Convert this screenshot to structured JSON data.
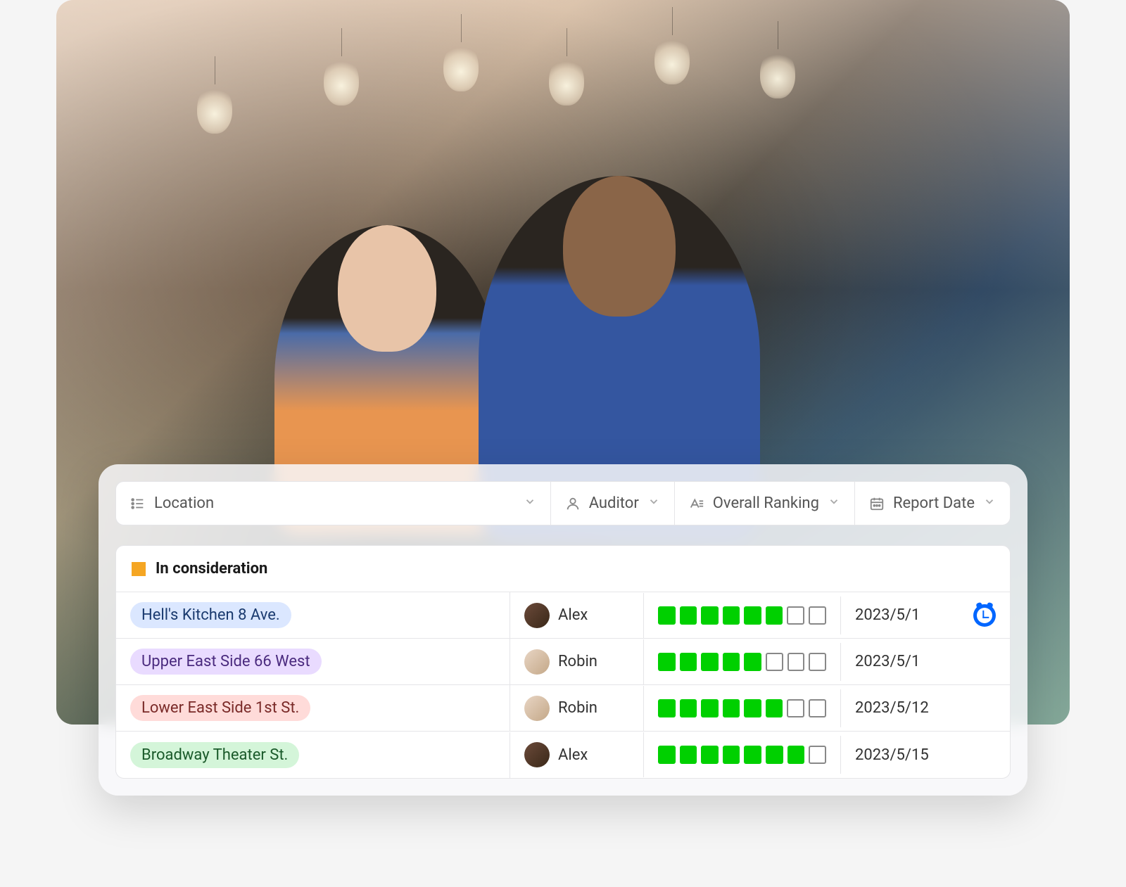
{
  "filters": {
    "location": "Location",
    "auditor": "Auditor",
    "ranking": "Overall Ranking",
    "date": "Report Date"
  },
  "group": {
    "title": "In consideration",
    "color": "#f5a623"
  },
  "rows": [
    {
      "location": "Hell's Kitchen 8 Ave.",
      "tag_bg": "#dbe7ff",
      "tag_color": "#1a3a6e",
      "auditor": "Alex",
      "avatar_bg": "linear-gradient(135deg,#6b4a3a,#3a2818)",
      "rank_filled": 6,
      "rank_total": 8,
      "date": "2023/5/1",
      "has_reminder": true
    },
    {
      "location": "Upper East Side 66 West",
      "tag_bg": "#e9dbff",
      "tag_color": "#4a2a7e",
      "auditor": "Robin",
      "avatar_bg": "linear-gradient(135deg,#e8d5c4,#c4a888)",
      "rank_filled": 5,
      "rank_total": 8,
      "date": "2023/5/1",
      "has_reminder": false
    },
    {
      "location": "Lower East Side 1st St.",
      "tag_bg": "#ffdbd9",
      "tag_color": "#7a2a28",
      "auditor": "Robin",
      "avatar_bg": "linear-gradient(135deg,#e8d5c4,#c4a888)",
      "rank_filled": 6,
      "rank_total": 8,
      "date": "2023/5/12",
      "has_reminder": false
    },
    {
      "location": "Broadway Theater St.",
      "tag_bg": "#d4f5d9",
      "tag_color": "#1a5a2a",
      "auditor": "Alex",
      "avatar_bg": "linear-gradient(135deg,#6b4a3a,#3a2818)",
      "rank_filled": 7,
      "rank_total": 8,
      "date": "2023/5/15",
      "has_reminder": false
    }
  ]
}
